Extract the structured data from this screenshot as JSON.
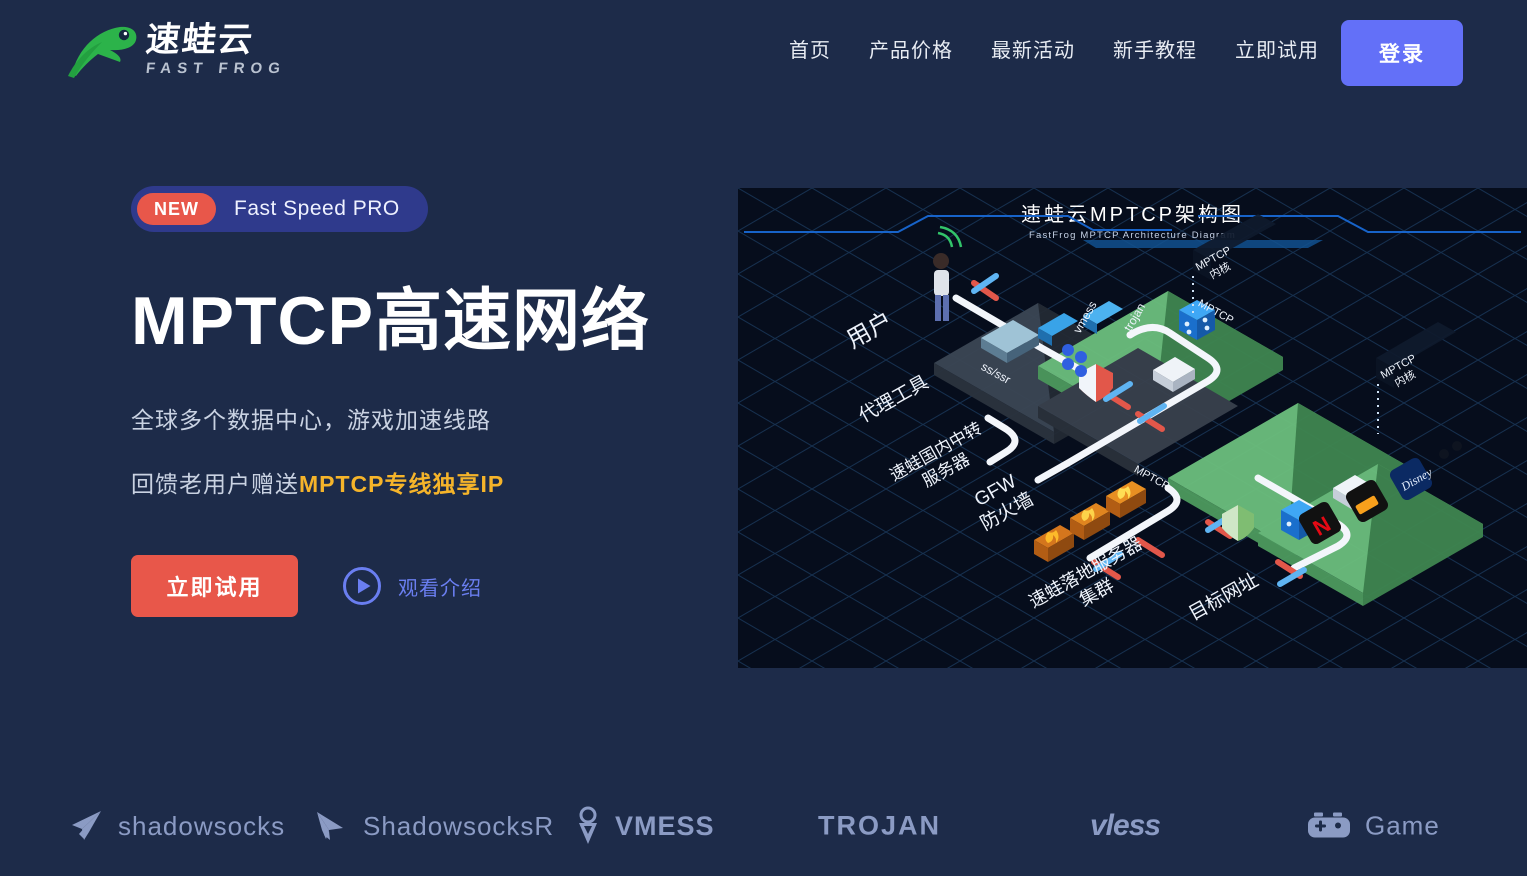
{
  "brand": {
    "logo_cn": "速蛙云",
    "logo_en": "FAST FROG",
    "logo_icon": "frog-icon",
    "green": "#2cb34a"
  },
  "header": {
    "nav_items": [
      {
        "label": "首页"
      },
      {
        "label": "产品价格"
      },
      {
        "label": "最新活动"
      },
      {
        "label": "新手教程"
      },
      {
        "label": "立即试用"
      }
    ],
    "login_label": "登录",
    "login_color": "#6370f8"
  },
  "hero": {
    "badge": {
      "tag": "NEW",
      "tag_color": "#e8574a",
      "label": "Fast Speed PRO",
      "background": "#2f3a8c"
    },
    "title": "MPTCP高速网络",
    "subtitle_1": "全球多个数据中心，游戏加速线路",
    "subtitle_2_prefix": "回馈老用户赠送",
    "subtitle_2_accent": "MPTCP专线独享IP",
    "accent_color": "#f5b42a",
    "cta_primary": "立即试用",
    "cta_primary_color": "#e8574a",
    "cta_secondary": "观看介绍",
    "cta_secondary_color": "#6a7ef0",
    "cta_secondary_icon": "play-circle-icon"
  },
  "diagram": {
    "title": "速蛙云MPTCP架构图",
    "subtitle": "FastFrog MPTCP Architecture Diagram",
    "background": "#060d1c",
    "labels": [
      {
        "text": "用户"
      },
      {
        "text": "代理工具"
      },
      {
        "text": "速蛙国内中转\n服务器"
      },
      {
        "text": "GFW\n防火墙"
      },
      {
        "text": "速蛙落地服务器\n集群"
      },
      {
        "text": "目标网址"
      },
      {
        "text": "MPTCP\n内核"
      },
      {
        "text": "MPTCP\n内核"
      },
      {
        "text": "MPTCP"
      },
      {
        "text": "MPTCP"
      },
      {
        "text": "ss/ssr"
      },
      {
        "text": "vmess"
      },
      {
        "text": "trojan"
      }
    ],
    "services": [
      "NETFLIX",
      "PornHub",
      "Disney+"
    ]
  },
  "protocols": [
    {
      "label": "shadowsocks",
      "icon": "paper-plane-icon"
    },
    {
      "label": "ShadowsocksR",
      "icon": "paper-plane-filled-icon"
    },
    {
      "label": "VMESS",
      "icon": "v-pin-icon"
    },
    {
      "label": "TROJAN",
      "icon": ""
    },
    {
      "label": "vless",
      "icon": ""
    },
    {
      "label": "Game",
      "icon": "gamepad-icon"
    }
  ],
  "theme": {
    "background": "#1d2b49",
    "text": "#e8ecf3"
  }
}
